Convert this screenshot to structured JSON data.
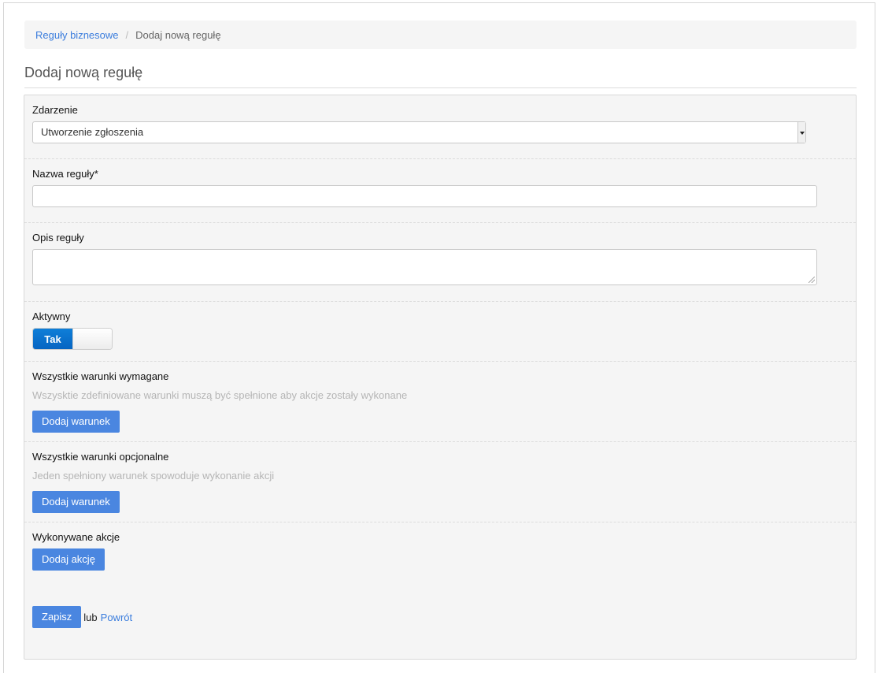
{
  "breadcrumb": {
    "parent": "Reguły biznesowe",
    "current": "Dodaj nową regułę"
  },
  "page_title": "Dodaj nową regułę",
  "form": {
    "event": {
      "label": "Zdarzenie",
      "selected": "Utworzenie zgłoszenia"
    },
    "rule_name": {
      "label": "Nazwa reguły*",
      "value": ""
    },
    "rule_description": {
      "label": "Opis reguły",
      "value": ""
    },
    "active": {
      "label": "Aktywny",
      "state_label": "Tak",
      "on": true
    },
    "required_conditions": {
      "label": "Wszystkie warunki wymagane",
      "hint": "Wszysktie zdefiniowane warunki muszą być spełnione aby akcje zostały wykonane",
      "button": "Dodaj warunek"
    },
    "optional_conditions": {
      "label": "Wszystkie warunki opcjonalne",
      "hint": "Jeden spełniony warunek spowoduje wykonanie akcji",
      "button": "Dodaj warunek"
    },
    "actions": {
      "label": "Wykonywane akcje",
      "button": "Dodaj akcję"
    },
    "footer": {
      "save": "Zapisz",
      "or": "lub",
      "back": "Powrót"
    }
  },
  "colors": {
    "accent": "#4a86e0",
    "link": "#3b7ddd",
    "toggle_on": "#0665c2"
  }
}
